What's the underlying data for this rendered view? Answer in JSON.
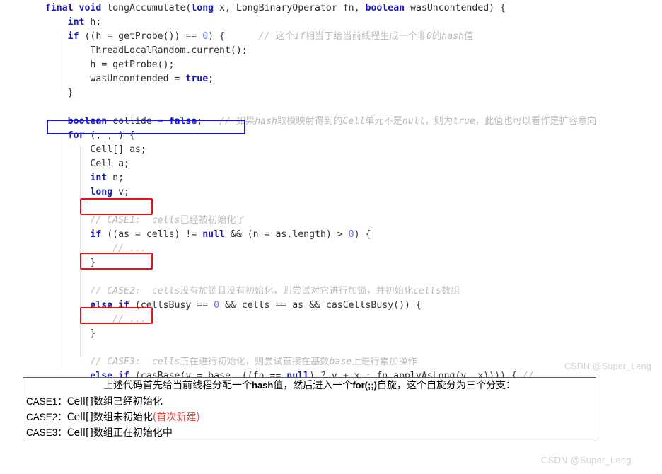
{
  "code": {
    "language": "java",
    "lines": [
      [
        {
          "t": "  ",
          "c": "plain"
        },
        {
          "t": "final",
          "c": "kw"
        },
        {
          "t": " ",
          "c": "plain"
        },
        {
          "t": "void",
          "c": "kw"
        },
        {
          "t": " longAccumulate(",
          "c": "plain"
        },
        {
          "t": "long",
          "c": "kw"
        },
        {
          "t": " x, LongBinaryOperator fn, ",
          "c": "plain"
        },
        {
          "t": "boolean",
          "c": "kw"
        },
        {
          "t": " wasUncontended) {",
          "c": "plain"
        }
      ],
      [
        {
          "t": "      ",
          "c": "plain"
        },
        {
          "t": "int",
          "c": "kw"
        },
        {
          "t": " h;",
          "c": "plain"
        }
      ],
      [
        {
          "t": "      ",
          "c": "plain"
        },
        {
          "t": "if",
          "c": "kw"
        },
        {
          "t": " ((h = getProbe()) == ",
          "c": "plain"
        },
        {
          "t": "0",
          "c": "num"
        },
        {
          "t": ") {      ",
          "c": "plain"
        },
        {
          "t": "// ",
          "c": "cmt"
        },
        {
          "t": "这个",
          "c": "cmt-cn"
        },
        {
          "t": "if",
          "c": "cmt"
        },
        {
          "t": "相当于给当前线程生成一个非",
          "c": "cmt-cn"
        },
        {
          "t": "0",
          "c": "cmt"
        },
        {
          "t": "的",
          "c": "cmt-cn"
        },
        {
          "t": "hash",
          "c": "cmt"
        },
        {
          "t": "值",
          "c": "cmt-cn"
        }
      ],
      [
        {
          "t": "          ThreadLocalRandom.current();",
          "c": "plain"
        }
      ],
      [
        {
          "t": "          h = getProbe();",
          "c": "plain"
        }
      ],
      [
        {
          "t": "          wasUncontended = ",
          "c": "plain"
        },
        {
          "t": "true",
          "c": "kw"
        },
        {
          "t": ";",
          "c": "plain"
        }
      ],
      [
        {
          "t": "      }",
          "c": "plain"
        }
      ],
      [],
      [
        {
          "t": "      ",
          "c": "plain"
        },
        {
          "t": "boolean",
          "c": "kw"
        },
        {
          "t": " collide = ",
          "c": "plain"
        },
        {
          "t": "false",
          "c": "kw"
        },
        {
          "t": ";   ",
          "c": "plain"
        },
        {
          "t": "// ",
          "c": "cmt"
        },
        {
          "t": "如果",
          "c": "cmt-cn"
        },
        {
          "t": "hash",
          "c": "cmt"
        },
        {
          "t": "取模映射得到的",
          "c": "cmt-cn"
        },
        {
          "t": "Cell",
          "c": "cmt"
        },
        {
          "t": "单元不是",
          "c": "cmt-cn"
        },
        {
          "t": "null",
          "c": "cmt"
        },
        {
          "t": "，则为",
          "c": "cmt-cn"
        },
        {
          "t": "true",
          "c": "cmt"
        },
        {
          "t": "，此值也可以看作是扩容意向",
          "c": "cmt-cn"
        }
      ],
      [
        {
          "t": "      ",
          "c": "plain"
        },
        {
          "t": "for",
          "c": "kw"
        },
        {
          "t": " (; ; ) {",
          "c": "plain"
        }
      ],
      [
        {
          "t": "          Cell[] as;",
          "c": "plain"
        }
      ],
      [
        {
          "t": "          Cell a;",
          "c": "plain"
        }
      ],
      [
        {
          "t": "          ",
          "c": "plain"
        },
        {
          "t": "int",
          "c": "kw"
        },
        {
          "t": " n;",
          "c": "plain"
        }
      ],
      [
        {
          "t": "          ",
          "c": "plain"
        },
        {
          "t": "long",
          "c": "kw"
        },
        {
          "t": " v;",
          "c": "plain"
        }
      ],
      [],
      [
        {
          "t": "          ",
          "c": "plain"
        },
        {
          "t": "// CASE1:",
          "c": "cmt"
        },
        {
          "t": "  ",
          "c": "cmt"
        },
        {
          "t": "cells",
          "c": "cmt"
        },
        {
          "t": "已经被初始化了",
          "c": "cmt-cn"
        }
      ],
      [
        {
          "t": "          ",
          "c": "plain"
        },
        {
          "t": "if",
          "c": "kw"
        },
        {
          "t": " ((as = cells) != ",
          "c": "plain"
        },
        {
          "t": "null",
          "c": "kw"
        },
        {
          "t": " && (n = as.length) > ",
          "c": "plain"
        },
        {
          "t": "0",
          "c": "num"
        },
        {
          "t": ") {",
          "c": "plain"
        }
      ],
      [
        {
          "t": "              ",
          "c": "plain"
        },
        {
          "t": "// ...",
          "c": "cmt"
        }
      ],
      [
        {
          "t": "          }",
          "c": "plain"
        }
      ],
      [],
      [
        {
          "t": "          ",
          "c": "plain"
        },
        {
          "t": "// CASE2:",
          "c": "cmt"
        },
        {
          "t": "  ",
          "c": "cmt"
        },
        {
          "t": "cells",
          "c": "cmt"
        },
        {
          "t": "没有加锁且没有初始化，则尝试对它进行加锁，并初始化",
          "c": "cmt-cn"
        },
        {
          "t": "cells",
          "c": "cmt"
        },
        {
          "t": "数组",
          "c": "cmt-cn"
        }
      ],
      [
        {
          "t": "          ",
          "c": "plain"
        },
        {
          "t": "else if",
          "c": "kw"
        },
        {
          "t": " (cellsBusy == ",
          "c": "plain"
        },
        {
          "t": "0",
          "c": "num"
        },
        {
          "t": " && cells == as && casCellsBusy()) {",
          "c": "plain"
        }
      ],
      [
        {
          "t": "              ",
          "c": "plain"
        },
        {
          "t": "// ...",
          "c": "cmt"
        }
      ],
      [
        {
          "t": "          }",
          "c": "plain"
        }
      ],
      [],
      [
        {
          "t": "          ",
          "c": "plain"
        },
        {
          "t": "// CASE3:",
          "c": "cmt"
        },
        {
          "t": "  ",
          "c": "cmt"
        },
        {
          "t": "cells",
          "c": "cmt"
        },
        {
          "t": "正在进行初始化，则尝试直接在基数",
          "c": "cmt-cn"
        },
        {
          "t": "base",
          "c": "cmt"
        },
        {
          "t": "上进行累加操作",
          "c": "cmt-cn"
        }
      ],
      [
        {
          "t": "          ",
          "c": "plain"
        },
        {
          "t": "else if",
          "c": "kw"
        },
        {
          "t": " (casBase(v = base, ((fn == ",
          "c": "plain"
        },
        {
          "t": "null",
          "c": "kw"
        },
        {
          "t": ") ? v + x : fn.applyAsLong(v, x)))) { ",
          "c": "plain"
        },
        {
          "t": "//",
          "c": "cmt"
        }
      ],
      [
        {
          "t": "              ",
          "c": "plain"
        },
        {
          "t": "// ...",
          "c": "cmt"
        }
      ],
      [
        {
          "t": "          }",
          "c": "plain"
        }
      ],
      [
        {
          "t": "      }",
          "c": "plain"
        }
      ]
    ]
  },
  "highlights": {
    "for_loop": {
      "label": "for (; ; ) {",
      "color": "#1414dd"
    },
    "case1": {
      "label": "// CASE1:",
      "color": "#ee1111"
    },
    "case2": {
      "label": "// CASE2:",
      "color": "#ee1111"
    },
    "case3": {
      "label": "// CASE3:",
      "color": "#ee1111"
    }
  },
  "case_table": {
    "header": {
      "pre": "上述代码首先给当前线程分配一个",
      "bold1": "hash",
      "mid": "值，然后进入一个",
      "bold2": "for(;;)",
      "post": "自旋，这个自旋分为三个分支："
    },
    "rows": [
      {
        "label": "CASE1：",
        "text": "Cell[]数组已经初始化",
        "note": ""
      },
      {
        "label": "CASE2：",
        "text": "Cell[]数组未初始化",
        "note": "(首次新建)"
      },
      {
        "label": "CASE3：",
        "text": "Cell[]数组正在初始化中",
        "note": ""
      }
    ]
  },
  "watermarks": {
    "top": "CSDN @Super_Leng",
    "bottom": "CSDN @Super_Leng"
  }
}
